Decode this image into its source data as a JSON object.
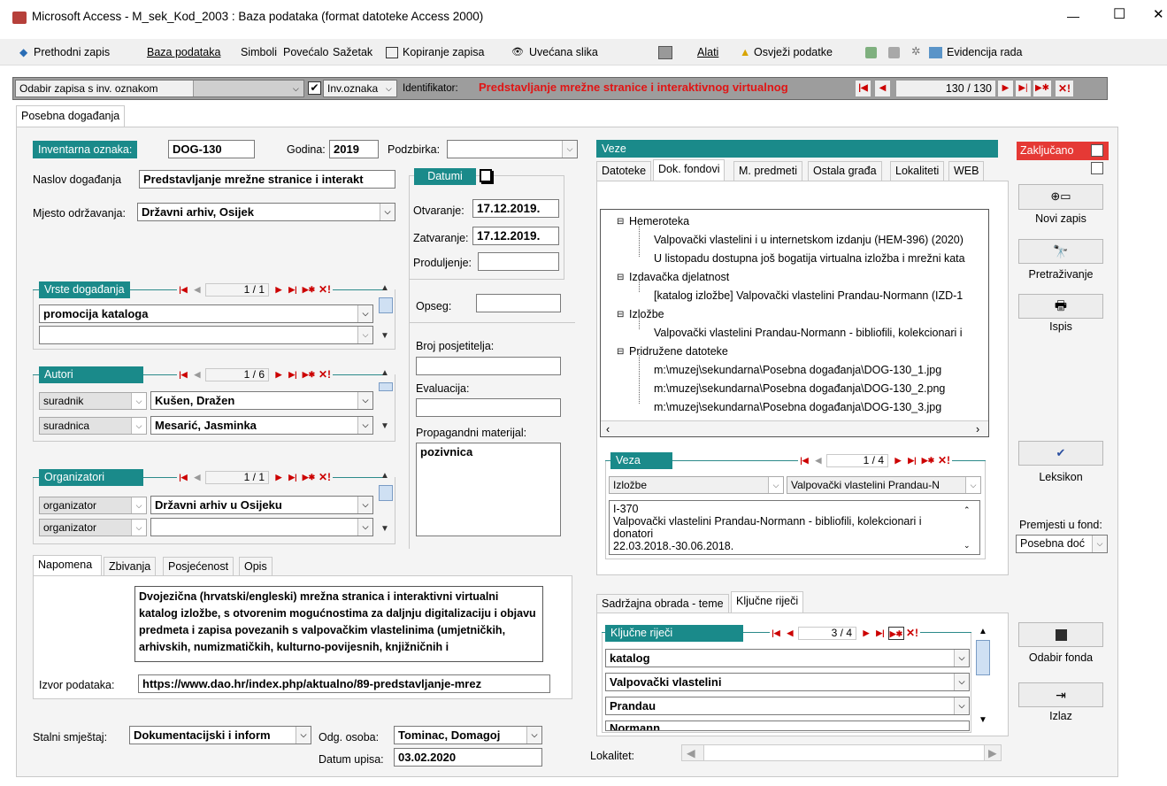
{
  "window": {
    "title": "Microsoft Access - M_sek_Kod_2003 : Baza podataka (format datoteke Access 2000)",
    "minimize": "—",
    "maximize": "☐",
    "close": "✕"
  },
  "menu": {
    "items": [
      "Prethodni zapis",
      "Baza podataka",
      "Simboli",
      "Povećalo",
      "Sažetak",
      "Kopiranje zapisa",
      "Uvećana slika",
      "Alati",
      "Osvježi podatke",
      "Evidencija rada"
    ]
  },
  "filterbar": {
    "select_label": "Odabir zapisa s inv. oznakom",
    "inv_label": "Inv.oznaka",
    "ident_label": "Identifikator:",
    "ident_value": "Predstavljanje mrežne stranice i interaktivnog virtualnog",
    "counter": "130 / 130"
  },
  "form_tab": "Posebna događanja",
  "left": {
    "inv_label": "Inventarna oznaka:",
    "inv_value": "DOG-130",
    "godina_label": "Godina:",
    "godina_value": "2019",
    "podzbirka_label": "Podzbirka:",
    "podzbirka_value": "",
    "naslov_label": "Naslov događanja",
    "naslov_value": "Predstavljanje mrežne stranice i interakt",
    "mjesto_label": "Mjesto održavanja:",
    "mjesto_value": "Državni arhiv, Osijek",
    "datumi_label": "Datumi",
    "otvaranje_label": "Otvaranje:",
    "otvaranje_value": "17.12.2019.",
    "zatvaranje_label": "Zatvaranje:",
    "zatvaranje_value": "17.12.2019.",
    "produljenje_label": "Produljenje:",
    "vrste_label": "Vrste događanja",
    "vrste_counter": "1 / 1",
    "vrste_items": [
      "promocija kataloga",
      ""
    ],
    "opseg_label": "Opseg:",
    "broj_label": "Broj posjetitelja:",
    "evaluacija_label": "Evaluacija:",
    "propagandni_label": "Propagandni materijal:",
    "propagandni_value": "pozivnica",
    "autori_label": "Autori",
    "autori_counter": "1 / 6",
    "autori": [
      {
        "role": "suradnik",
        "name": "Kušen, Dražen"
      },
      {
        "role": "suradnica",
        "name": "Mesarić, Jasminka"
      }
    ],
    "org_label": "Organizatori",
    "org_counter": "1 / 1",
    "org": [
      {
        "role": "organizator",
        "name": "Državni arhiv u Osijeku"
      },
      {
        "role": "organizator",
        "name": ""
      }
    ],
    "tabs": [
      "Napomena",
      "Zbivanja",
      "Posjećenost",
      "Opis"
    ],
    "napomena": "Dvojezična (hrvatski/engleski) mrežna stranica i interaktivni virtualni katalog izložbe, s otvorenim mogućnostima za daljnju digitalizaciju i objavu predmeta i zapisa povezanih s valpovačkim vlastelinima (umjetničkih, arhivskih, numizmatičkih, kulturno-povijesnih, knjižničnih i",
    "izvor_label": "Izvor podataka:",
    "izvor_value": "https://www.dao.hr/index.php/aktualno/89-predstavljanje-mrez",
    "smjestaj_label": "Stalni smještaj:",
    "smjestaj_value": "Dokumentacijski i inform",
    "osoba_label": "Odg. osoba:",
    "osoba_value": "Tominac, Domagoj",
    "upis_label": "Datum upisa:",
    "upis_value": "03.02.2020"
  },
  "veze": {
    "header": "Veze",
    "tabs": [
      "Datoteke",
      "Dok. fondovi",
      "M. predmeti",
      "Ostala građa",
      "Lokaliteti",
      "WEB"
    ],
    "tree": [
      {
        "level": 0,
        "text": "Hemeroteka"
      },
      {
        "level": 1,
        "text": "Valpovački vlastelini i u internetskom izdanju (HEM-396) (2020)"
      },
      {
        "level": 1,
        "text": "U listopadu dostupna još bogatija virtualna izložba i mrežni kata"
      },
      {
        "level": 0,
        "text": "Izdavačka djelatnost"
      },
      {
        "level": 1,
        "text": "[katalog izložbe] Valpovački vlastelini Prandau-Normann (IZD-1"
      },
      {
        "level": 0,
        "text": "Izložbe"
      },
      {
        "level": 1,
        "text": "Valpovački vlastelini Prandau-Normann - bibliofili, kolekcionari i"
      },
      {
        "level": 0,
        "text": "Pridružene datoteke"
      },
      {
        "level": 1,
        "text": "m:\\muzej\\sekundarna\\Posebna događanja\\DOG-130_1.jpg"
      },
      {
        "level": 1,
        "text": "m:\\muzej\\sekundarna\\Posebna događanja\\DOG-130_2.png"
      },
      {
        "level": 1,
        "text": "m:\\muzej\\sekundarna\\Posebna događanja\\DOG-130_3.jpg"
      }
    ],
    "veza_label": "Veza",
    "veza_counter": "1 / 4",
    "veza_type": "Izložbe",
    "veza_value": "Valpovački vlastelini Prandau-N",
    "veza_text": [
      "I-370",
      "Valpovački vlastelini Prandau-Normann - bibliofili, kolekcionari i",
      "donatori",
      "22.03.2018.-30.06.2018."
    ],
    "sub_tabs": [
      "Sadržajna obrada - teme",
      "Ključne riječi"
    ],
    "kljucne_label": "Ključne riječi",
    "kljucne_counter": "3 / 4",
    "kljucne": [
      "katalog",
      "Valpovački vlastelini",
      "Prandau",
      "Normann"
    ],
    "lokalitet_label": "Lokalitet:"
  },
  "right": {
    "zakljucano": "Zaključano",
    "novi": "Novi zapis",
    "pretrazivanje": "Pretraživanje",
    "ispis": "Ispis",
    "leksikon": "Leksikon",
    "premjesti_label": "Premjesti u fond:",
    "premjesti_value": "Posebna doć",
    "odabir": "Odabir fonda",
    "izlaz": "Izlaz"
  },
  "colors": {
    "teal": "#1a8a8a",
    "red": "#e53935",
    "toolbar": "#f0f0f0",
    "formbg": "#f4f4f4"
  }
}
